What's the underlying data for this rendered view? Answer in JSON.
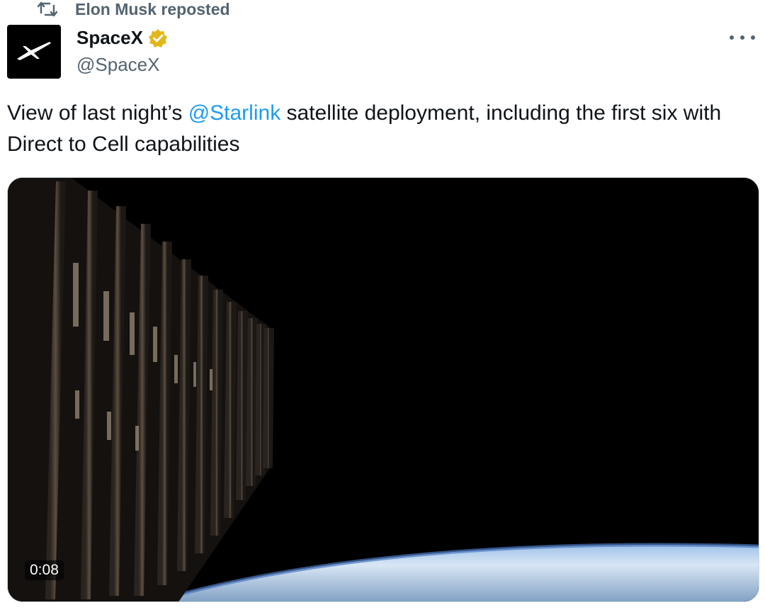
{
  "repost": {
    "icon": "repost-icon",
    "label": "Elon Musk reposted"
  },
  "author": {
    "display_name": "SpaceX",
    "handle": "@SpaceX",
    "avatar_icon": "spacex-x-logo",
    "verified_icon": "verified-badge-icon",
    "verified_color": "#e2b719"
  },
  "menu": {
    "icon": "more-options-icon"
  },
  "tweet": {
    "text_before": "View of last night’s ",
    "mention": "@Starlink",
    "text_after": " satellite deployment, including the first six with Direct to Cell capabilities"
  },
  "media": {
    "type": "video",
    "duration": "0:08"
  },
  "colors": {
    "link": "#1d9bf0",
    "secondary_text": "#536471",
    "primary_text": "#0f1419"
  }
}
